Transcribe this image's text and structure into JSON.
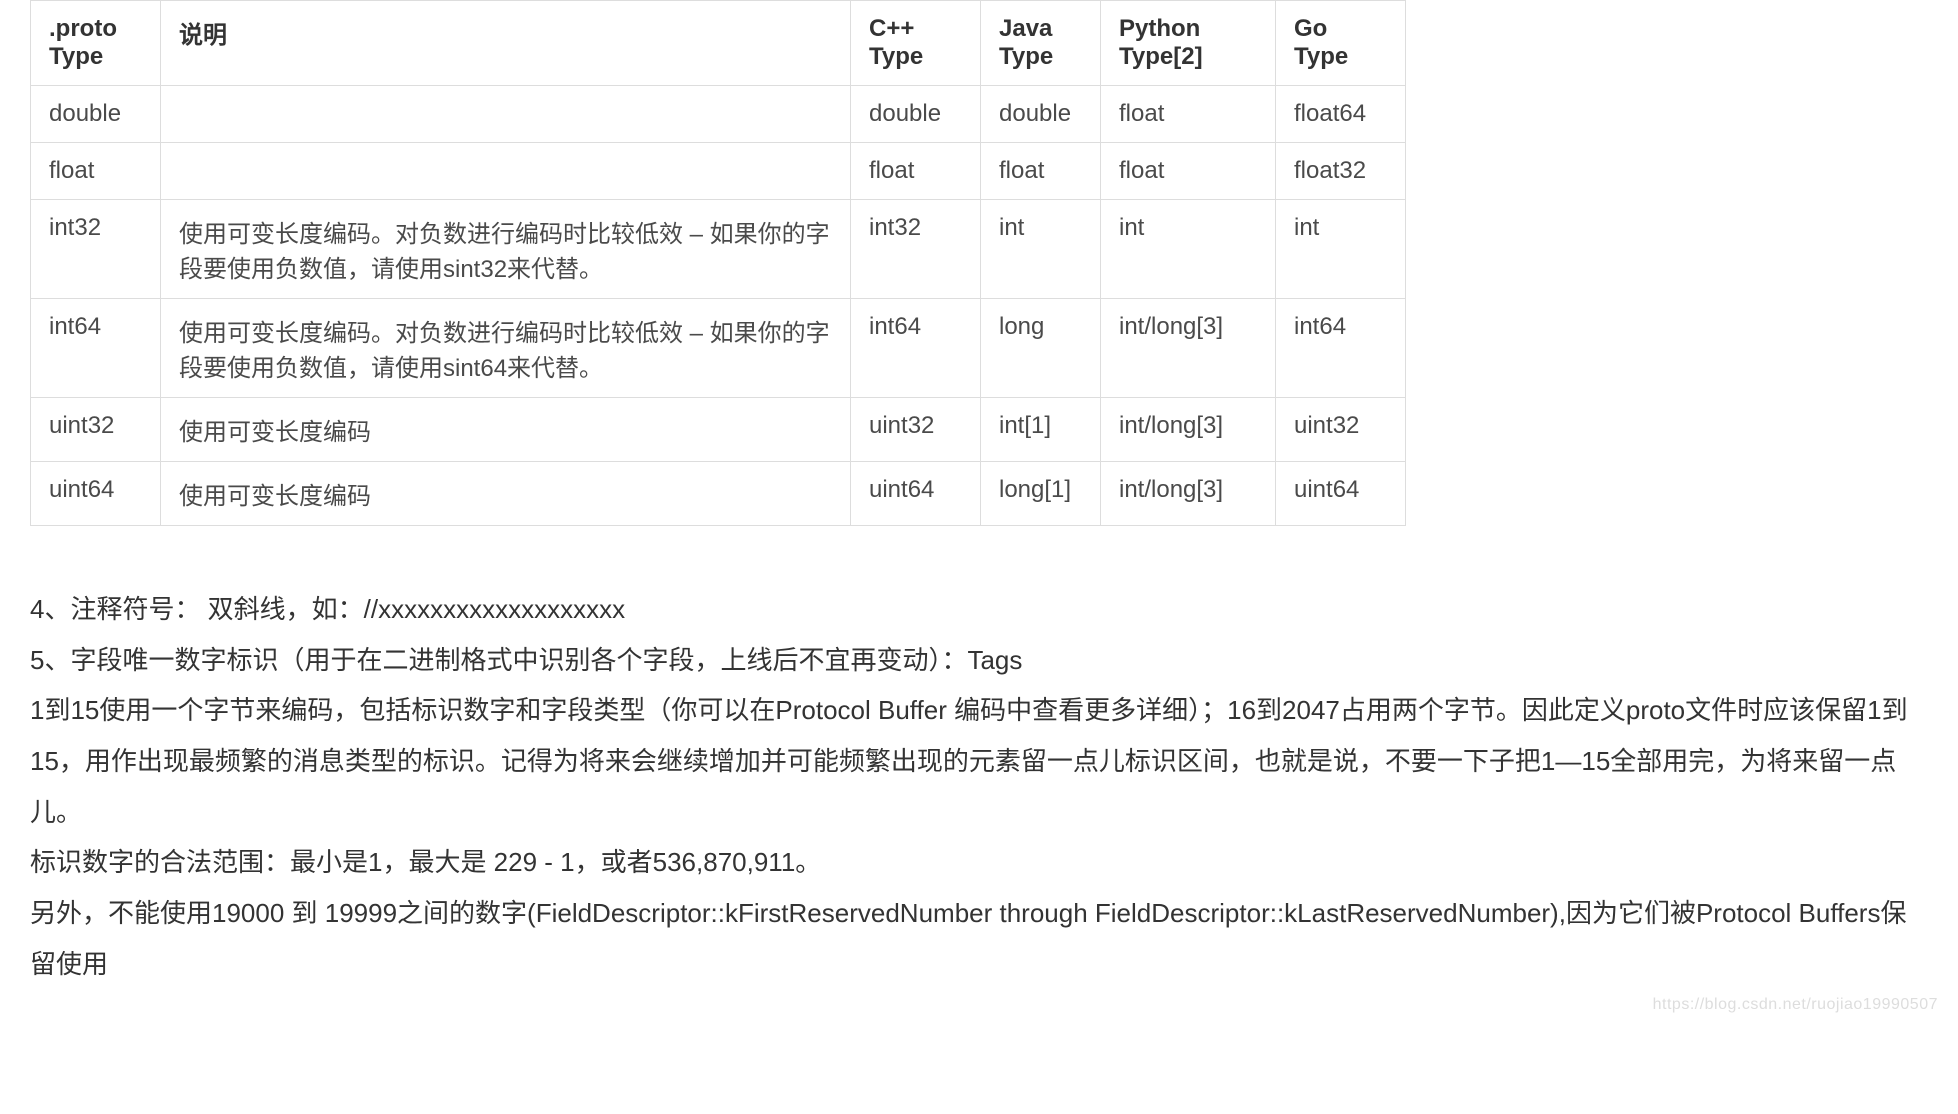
{
  "table": {
    "headers": {
      "proto": ".proto Type",
      "desc": "说明",
      "cpp": "C++ Type",
      "java": "Java Type",
      "python": "Python Type[2]",
      "go": "Go Type"
    },
    "rows": [
      {
        "proto": "double",
        "desc": "",
        "cpp": "double",
        "java": "double",
        "python": "float",
        "go": "float64"
      },
      {
        "proto": "float",
        "desc": "",
        "cpp": "float",
        "java": "float",
        "python": "float",
        "go": "float32"
      },
      {
        "proto": "int32",
        "desc": "使用可变长度编码。对负数进行编码时比较低效 – 如果你的字段要使用负数值，请使用sint32来代替。",
        "cpp": "int32",
        "java": "int",
        "python": "int",
        "go": "int"
      },
      {
        "proto": "int64",
        "desc": "使用可变长度编码。对负数进行编码时比较低效 – 如果你的字段要使用负数值，请使用sint64来代替。",
        "cpp": "int64",
        "java": "long",
        "python": "int/long[3]",
        "go": "int64"
      },
      {
        "proto": "uint32",
        "desc": "使用可变长度编码",
        "cpp": "uint32",
        "java": "int[1]",
        "python": "int/long[3]",
        "go": "uint32"
      },
      {
        "proto": "uint64",
        "desc": "使用可变长度编码",
        "cpp": "uint64",
        "java": "long[1]",
        "python": "int/long[3]",
        "go": "uint64"
      }
    ]
  },
  "paragraphs": {
    "p1": "4、注释符号： 双斜线，如：//xxxxxxxxxxxxxxxxxxx",
    "p2": "5、字段唯一数字标识（用于在二进制格式中识别各个字段，上线后不宜再变动）：Tags",
    "p3": "1到15使用一个字节来编码，包括标识数字和字段类型（你可以在Protocol Buffer 编码中查看更多详细）；16到2047占用两个字节。因此定义proto文件时应该保留1到15，用作出现最频繁的消息类型的标识。记得为将来会继续增加并可能频繁出现的元素留一点儿标识区间，也就是说，不要一下子把1—15全部用完，为将来留一点儿。",
    "p4": "标识数字的合法范围：最小是1，最大是 229 - 1，或者536,870,911。",
    "p5": "另外，不能使用19000 到 19999之间的数字(FieldDescriptor::kFirstReservedNumber through FieldDescriptor::kLastReservedNumber),因为它们被Protocol Buffers保留使用"
  },
  "watermark": "https://blog.csdn.net/ruojiao19990507"
}
